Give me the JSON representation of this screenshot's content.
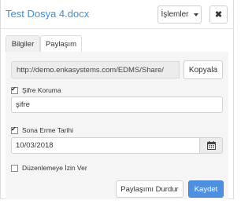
{
  "window": {
    "title": "Test Dosya 4.docx"
  },
  "header": {
    "actions_label": "İşlemler",
    "close_symbol": "✖"
  },
  "tabs": [
    {
      "label": "Bilgiler",
      "active": false
    },
    {
      "label": "Paylaşım",
      "active": true
    }
  ],
  "share": {
    "url": "http://demo.enkasystems.com/EDMS/Share/",
    "copy_label": "Kopyala",
    "password_protect": {
      "label": "Şifre Koruma",
      "checked": true
    },
    "password_value": "şifre",
    "expiry": {
      "label": "Sona Erme Tarihi",
      "checked": true
    },
    "expiry_date": "10/03/2018",
    "prevent_edit": {
      "label": "Düzenlemeye İzin Ver",
      "checked": false
    },
    "stop_label": "Paylaşımı Durdur",
    "save_label": "Kaydet"
  },
  "colors": {
    "title": "#3d8fd1",
    "primary_button": "#4f8fe0"
  }
}
